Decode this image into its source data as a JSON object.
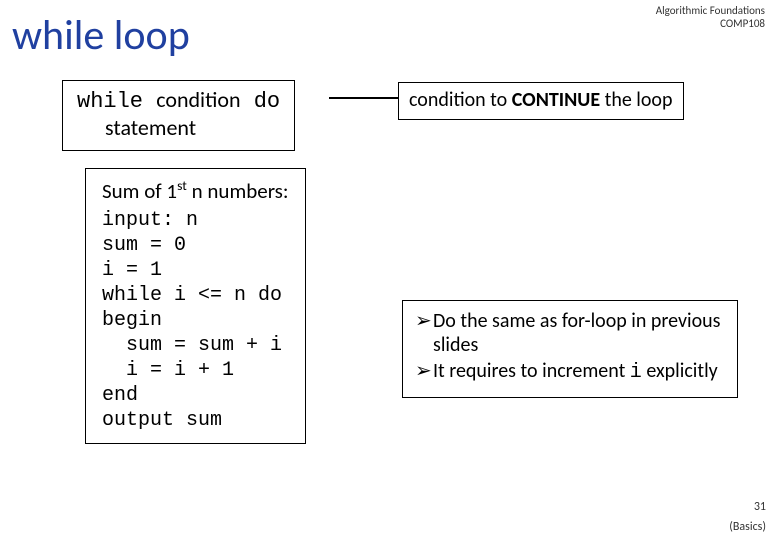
{
  "header": {
    "course_line1": "Algorithmic Foundations",
    "course_line2": "COMP108"
  },
  "title": "while loop",
  "syntax": {
    "line1_pre": "while ",
    "line1_cond": "condition",
    "line1_post": " do",
    "line2": "statement"
  },
  "condition_annot": {
    "pre": "condition to ",
    "strong": "CONTINUE",
    "post": " the loop"
  },
  "example": {
    "heading_pre": "Sum of 1",
    "heading_ord": "st",
    "heading_post": " n numbers:",
    "code": "input: n\nsum = 0\ni = 1\nwhile i <= n do\nbegin\n  sum = sum + i\n  i = i + 1\nend\noutput sum"
  },
  "notes": {
    "bullet": "➢",
    "item1": "Do the same as for-loop in previous slides",
    "item2_pre": "It requires to increment ",
    "item2_code": "i",
    "item2_post": " explicitly"
  },
  "footer": {
    "page_num": "31",
    "section": "(Basics)"
  }
}
